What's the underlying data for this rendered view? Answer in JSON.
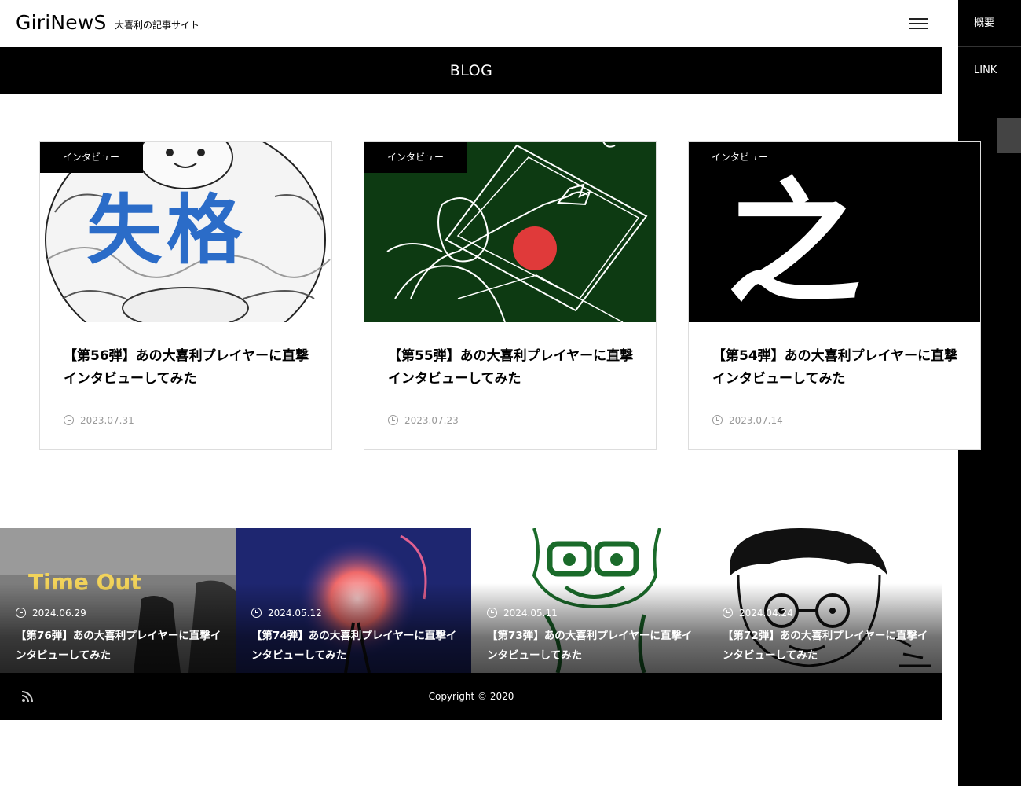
{
  "header": {
    "logo": "GiriNewS",
    "tagline": "大喜利の記事サイト"
  },
  "blog_bar": {
    "title": "BLOG"
  },
  "side_menu": {
    "items": [
      {
        "label": "概要"
      },
      {
        "label": "LINK"
      }
    ]
  },
  "cards": [
    {
      "category": "インタビュー",
      "title": "【第56弾】あの大喜利プレイヤーに直撃インタビューしてみた",
      "date": "2023.07.31",
      "thumb_text": "失格"
    },
    {
      "category": "インタビュー",
      "title": "【第55弾】あの大喜利プレイヤーに直撃インタビューしてみた",
      "date": "2023.07.23"
    },
    {
      "category": "インタビュー",
      "title": "【第54弾】あの大喜利プレイヤーに直撃インタビューしてみた",
      "date": "2023.07.14",
      "thumb_text": "之"
    }
  ],
  "tiles": [
    {
      "date": "2024.06.29",
      "title": "【第76弾】あの大喜利プレイヤーに直撃インタビューしてみた",
      "thumb_text": "Time Out"
    },
    {
      "date": "2024.05.12",
      "title": "【第74弾】あの大喜利プレイヤーに直撃インタビューしてみた"
    },
    {
      "date": "2024.05.11",
      "title": "【第73弾】あの大喜利プレイヤーに直撃インタビューしてみた"
    },
    {
      "date": "2024.04.24",
      "title": "【第72弾】あの大喜利プレイヤーに直撃インタビューしてみた"
    }
  ],
  "footer": {
    "copyright": "Copyright © 2020"
  },
  "colors": {
    "accent": "#000000",
    "blue_text": "#2b6cc8",
    "board_green": "#0d3a12",
    "red_ball": "#e03a3a"
  }
}
